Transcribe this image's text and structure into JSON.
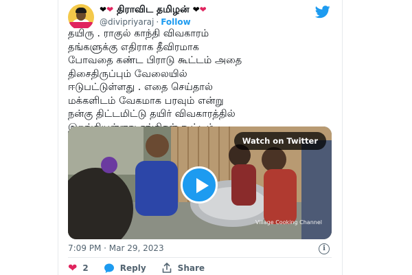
{
  "author": {
    "display_name": "திராவிட தமிழன்",
    "heart_black": "❤",
    "heart_red": "❤",
    "handle": "@divipriyaraj",
    "separator": "·",
    "follow_label": "Follow"
  },
  "tweet": {
    "text": "தயிரு . ராகுல் காந்தி விவகாரம்\nதங்களுக்கு எதிராக தீவிரமாக\nபோவதை கண்ட பிராடு கூட்டம் அதை\nதிசைதிருப்பும் வேலையில்\nஈடுபட்டுள்ளது . எதை செய்தால்\nமக்களிடம் வேகமாக பரவும் என்று\nநன்கு திட்டமிட்டு தயிர் விவகாரத்தில்\nஇறங்கியுள்ளது சங்கிகள் கூட்டம்."
  },
  "media": {
    "watch_label": "Watch on Twitter",
    "watermark": "Village Cooking Channel"
  },
  "meta": {
    "timestamp": "7:09 PM · Mar 29, 2023",
    "info_glyph": "i"
  },
  "actions": {
    "like_count": "2",
    "reply_label": "Reply",
    "share_label": "Share"
  },
  "colors": {
    "accent": "#1d9bf0",
    "like": "#e0245e",
    "muted": "#536471"
  },
  "icons": [
    "avatar",
    "twitter-bird-icon",
    "play-icon",
    "info-icon",
    "heart-icon",
    "reply-icon",
    "share-icon"
  ]
}
